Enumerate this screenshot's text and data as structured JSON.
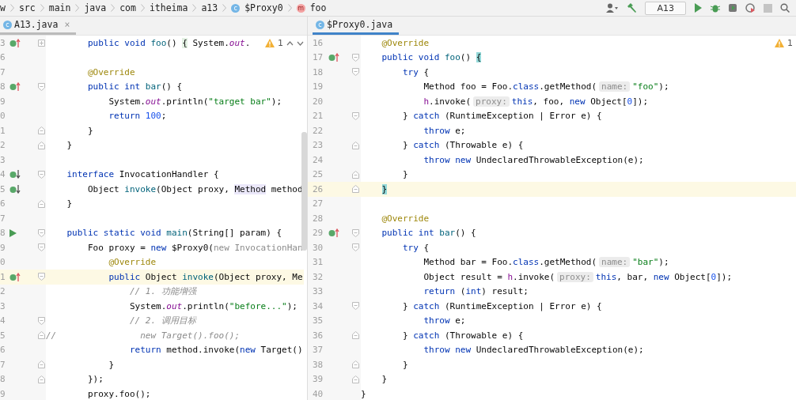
{
  "breadcrumbs": [
    {
      "label": "w",
      "kind": "folder"
    },
    {
      "label": "src",
      "kind": "folder"
    },
    {
      "label": "main",
      "kind": "folder"
    },
    {
      "label": "java",
      "kind": "folder"
    },
    {
      "label": "com",
      "kind": "folder"
    },
    {
      "label": "itheima",
      "kind": "folder"
    },
    {
      "label": "a13",
      "kind": "folder"
    },
    {
      "label": "$Proxy0",
      "kind": "class",
      "badge": "c"
    },
    {
      "label": "foo",
      "kind": "method",
      "badge": "m"
    }
  ],
  "toolbar": {
    "run_config": "A13"
  },
  "panes": [
    {
      "tab": {
        "label": "A13.java",
        "badge": "c",
        "close": "×",
        "focused": false
      },
      "warning": {
        "count": "1",
        "nav": true
      },
      "lines": [
        {
          "no": "3",
          "gutter_icon": {
            "kind": "override"
          },
          "fold": {
            "kind": "collapsed"
          },
          "current": false,
          "tokens": [
            {
              "kind": "keyword",
              "text": "        public void "
            },
            {
              "kind": "method",
              "text": "foo"
            },
            {
              "kind": "plain",
              "text": "() "
            },
            {
              "kind": "folded",
              "text": "{"
            },
            {
              "kind": "plain",
              "text": " System."
            },
            {
              "kind": "field",
              "text": "out"
            },
            {
              "kind": "plain",
              "text": "."
            }
          ]
        },
        {
          "no": "6",
          "current": false
        },
        {
          "no": "7",
          "current": false,
          "tokens": [
            {
              "kind": "annotation",
              "text": "        @Override"
            }
          ]
        },
        {
          "no": "8",
          "gutter_icon": {
            "kind": "override"
          },
          "fold": {
            "kind": "start"
          },
          "current": false,
          "tokens": [
            {
              "kind": "keyword",
              "text": "        public int "
            },
            {
              "kind": "method",
              "text": "bar"
            },
            {
              "kind": "plain",
              "text": "() {"
            }
          ]
        },
        {
          "no": "9",
          "current": false,
          "tokens": [
            {
              "kind": "plain",
              "text": "            System."
            },
            {
              "kind": "field",
              "text": "out"
            },
            {
              "kind": "plain",
              "text": ".println("
            },
            {
              "kind": "string",
              "text": "\"target bar\""
            },
            {
              "kind": "plain",
              "text": ");"
            }
          ]
        },
        {
          "no": "0",
          "current": false,
          "tokens": [
            {
              "kind": "keyword",
              "text": "            return "
            },
            {
              "kind": "number",
              "text": "100"
            },
            {
              "kind": "plain",
              "text": ";"
            }
          ]
        },
        {
          "no": "1",
          "fold": {
            "kind": "end"
          },
          "current": false,
          "tokens": [
            {
              "kind": "plain",
              "text": "        }"
            }
          ]
        },
        {
          "no": "2",
          "fold": {
            "kind": "end"
          },
          "current": false,
          "tokens": [
            {
              "kind": "plain",
              "text": "    }"
            }
          ]
        },
        {
          "no": "3",
          "current": false
        },
        {
          "no": "4",
          "gutter_icon": {
            "kind": "implemented"
          },
          "fold": {
            "kind": "start"
          },
          "current": false,
          "tokens": [
            {
              "kind": "keyword",
              "text": "    interface "
            },
            {
              "kind": "plain",
              "text": "InvocationHandler {"
            }
          ]
        },
        {
          "no": "5",
          "gutter_icon": {
            "kind": "implemented"
          },
          "current": false,
          "tokens": [
            {
              "kind": "plain",
              "text": "        Object "
            },
            {
              "kind": "method",
              "text": "invoke"
            },
            {
              "kind": "plain",
              "text": "(Object proxy, "
            },
            {
              "kind": "usage",
              "text": "Method"
            },
            {
              "kind": "plain",
              "text": " method"
            }
          ]
        },
        {
          "no": "6",
          "fold": {
            "kind": "end"
          },
          "current": false,
          "tokens": [
            {
              "kind": "plain",
              "text": "    }"
            }
          ]
        },
        {
          "no": "7",
          "current": false
        },
        {
          "no": "8",
          "gutter_icon": {
            "kind": "run"
          },
          "fold": {
            "kind": "start"
          },
          "current": false,
          "tokens": [
            {
              "kind": "keyword",
              "text": "    public static void "
            },
            {
              "kind": "method",
              "text": "main"
            },
            {
              "kind": "plain",
              "text": "(String[] param) {"
            }
          ]
        },
        {
          "no": "9",
          "fold": {
            "kind": "start"
          },
          "current": false,
          "tokens": [
            {
              "kind": "plain",
              "text": "        Foo proxy = "
            },
            {
              "kind": "keyword",
              "text": "new "
            },
            {
              "kind": "plain",
              "text": "$Proxy0("
            },
            {
              "kind": "dim",
              "text": "new InvocationHan"
            }
          ]
        },
        {
          "no": "0",
          "current": false,
          "tokens": [
            {
              "kind": "annotation",
              "text": "            @Override"
            }
          ]
        },
        {
          "no": "1",
          "gutter_icon": {
            "kind": "override"
          },
          "fold": {
            "kind": "start"
          },
          "current": true,
          "tokens": [
            {
              "kind": "keyword",
              "text": "            public "
            },
            {
              "kind": "plain",
              "text": "Object "
            },
            {
              "kind": "method",
              "text": "invoke"
            },
            {
              "kind": "plain",
              "text": "(Object proxy, Me"
            }
          ]
        },
        {
          "no": "2",
          "current": false,
          "tokens": [
            {
              "kind": "comment",
              "text": "                // 1. 功能增强"
            }
          ]
        },
        {
          "no": "3",
          "current": false,
          "tokens": [
            {
              "kind": "plain",
              "text": "                System."
            },
            {
              "kind": "field",
              "text": "out"
            },
            {
              "kind": "plain",
              "text": ".println("
            },
            {
              "kind": "string",
              "text": "\"before...\""
            },
            {
              "kind": "plain",
              "text": ");"
            }
          ]
        },
        {
          "no": "4",
          "fold": {
            "kind": "start"
          },
          "current": false,
          "tokens": [
            {
              "kind": "comment",
              "text": "                // 2. 调用目标"
            }
          ]
        },
        {
          "no": "5",
          "fold": {
            "kind": "end"
          },
          "current": false,
          "tokens": [
            {
              "kind": "comment",
              "text": "//                new Target().foo();"
            }
          ]
        },
        {
          "no": "6",
          "current": false,
          "tokens": [
            {
              "kind": "keyword",
              "text": "                return "
            },
            {
              "kind": "plain",
              "text": "method.invoke("
            },
            {
              "kind": "keyword",
              "text": "new "
            },
            {
              "kind": "plain",
              "text": "Target()"
            }
          ]
        },
        {
          "no": "7",
          "fold": {
            "kind": "end"
          },
          "current": false,
          "tokens": [
            {
              "kind": "plain",
              "text": "            }"
            }
          ]
        },
        {
          "no": "8",
          "fold": {
            "kind": "end"
          },
          "current": false,
          "tokens": [
            {
              "kind": "plain",
              "text": "        });"
            }
          ]
        },
        {
          "no": "9",
          "current": false,
          "tokens": [
            {
              "kind": "plain",
              "text": "        proxy.foo();"
            }
          ]
        }
      ]
    },
    {
      "tab": {
        "label": "$Proxy0.java",
        "badge": "c",
        "focused": true
      },
      "warning": {
        "count": "1",
        "nav": false
      },
      "lines": [
        {
          "no": "16",
          "current": false,
          "tokens": [
            {
              "kind": "annotation",
              "text": "    @Override"
            }
          ]
        },
        {
          "no": "17",
          "gutter_icon": {
            "kind": "override"
          },
          "fold": {
            "kind": "start"
          },
          "current": false,
          "tokens": [
            {
              "kind": "keyword",
              "text": "    public void "
            },
            {
              "kind": "method",
              "text": "foo"
            },
            {
              "kind": "plain",
              "text": "() "
            },
            {
              "kind": "brace",
              "text": "{"
            }
          ]
        },
        {
          "no": "18",
          "fold": {
            "kind": "start"
          },
          "current": false,
          "tokens": [
            {
              "kind": "keyword",
              "text": "        try"
            },
            {
              "kind": "plain",
              "text": " {"
            }
          ]
        },
        {
          "no": "19",
          "current": false,
          "tokens": [
            {
              "kind": "plain",
              "text": "            Method foo = Foo."
            },
            {
              "kind": "keyword",
              "text": "class"
            },
            {
              "kind": "plain",
              "text": ".getMethod("
            },
            {
              "kind": "hint",
              "text": "name:"
            },
            {
              "kind": "string",
              "text": "\"foo\""
            },
            {
              "kind": "plain",
              "text": ");"
            }
          ]
        },
        {
          "no": "20",
          "current": false,
          "tokens": [
            {
              "kind": "member",
              "text": "            h"
            },
            {
              "kind": "plain",
              "text": ".invoke("
            },
            {
              "kind": "hint",
              "text": "proxy:"
            },
            {
              "kind": "keyword",
              "text": "this"
            },
            {
              "kind": "plain",
              "text": ", foo, "
            },
            {
              "kind": "keyword",
              "text": "new "
            },
            {
              "kind": "plain",
              "text": "Object["
            },
            {
              "kind": "number",
              "text": "0"
            },
            {
              "kind": "plain",
              "text": "]);"
            }
          ]
        },
        {
          "no": "21",
          "fold": {
            "kind": "start"
          },
          "current": false,
          "tokens": [
            {
              "kind": "plain",
              "text": "        } "
            },
            {
              "kind": "keyword",
              "text": "catch"
            },
            {
              "kind": "plain",
              "text": " (RuntimeException | Error e) {"
            }
          ]
        },
        {
          "no": "22",
          "current": false,
          "tokens": [
            {
              "kind": "keyword",
              "text": "            throw"
            },
            {
              "kind": "plain",
              "text": " e;"
            }
          ]
        },
        {
          "no": "23",
          "fold": {
            "kind": "end"
          },
          "current": false,
          "tokens": [
            {
              "kind": "plain",
              "text": "        } "
            },
            {
              "kind": "keyword",
              "text": "catch"
            },
            {
              "kind": "plain",
              "text": " (Throwable e) {"
            }
          ]
        },
        {
          "no": "24",
          "current": false,
          "tokens": [
            {
              "kind": "keyword",
              "text": "            throw new "
            },
            {
              "kind": "plain",
              "text": "UndeclaredThrowableException(e);"
            }
          ]
        },
        {
          "no": "25",
          "fold": {
            "kind": "end"
          },
          "current": false,
          "tokens": [
            {
              "kind": "plain",
              "text": "        }"
            }
          ]
        },
        {
          "no": "26",
          "fold": {
            "kind": "end"
          },
          "current": true,
          "tokens": [
            {
              "kind": "brace",
              "text": "    }"
            }
          ]
        },
        {
          "no": "27",
          "current": false
        },
        {
          "no": "28",
          "current": false,
          "tokens": [
            {
              "kind": "annotation",
              "text": "    @Override"
            }
          ]
        },
        {
          "no": "29",
          "gutter_icon": {
            "kind": "override"
          },
          "fold": {
            "kind": "start"
          },
          "current": false,
          "tokens": [
            {
              "kind": "keyword",
              "text": "    public int "
            },
            {
              "kind": "method",
              "text": "bar"
            },
            {
              "kind": "plain",
              "text": "() {"
            }
          ]
        },
        {
          "no": "30",
          "fold": {
            "kind": "start"
          },
          "current": false,
          "tokens": [
            {
              "kind": "keyword",
              "text": "        try"
            },
            {
              "kind": "plain",
              "text": " {"
            }
          ]
        },
        {
          "no": "31",
          "current": false,
          "tokens": [
            {
              "kind": "plain",
              "text": "            Method bar = Foo."
            },
            {
              "kind": "keyword",
              "text": "class"
            },
            {
              "kind": "plain",
              "text": ".getMethod("
            },
            {
              "kind": "hint",
              "text": "name:"
            },
            {
              "kind": "string",
              "text": "\"bar\""
            },
            {
              "kind": "plain",
              "text": ");"
            }
          ]
        },
        {
          "no": "32",
          "current": false,
          "tokens": [
            {
              "kind": "plain",
              "text": "            Object result = "
            },
            {
              "kind": "member",
              "text": "h"
            },
            {
              "kind": "plain",
              "text": ".invoke("
            },
            {
              "kind": "hint",
              "text": "proxy:"
            },
            {
              "kind": "keyword",
              "text": "this"
            },
            {
              "kind": "plain",
              "text": ", bar, "
            },
            {
              "kind": "keyword",
              "text": "new "
            },
            {
              "kind": "plain",
              "text": "Object["
            },
            {
              "kind": "number",
              "text": "0"
            },
            {
              "kind": "plain",
              "text": "]);"
            }
          ]
        },
        {
          "no": "33",
          "current": false,
          "tokens": [
            {
              "kind": "keyword",
              "text": "            return "
            },
            {
              "kind": "plain",
              "text": "("
            },
            {
              "kind": "keyword",
              "text": "int"
            },
            {
              "kind": "plain",
              "text": ") result;"
            }
          ]
        },
        {
          "no": "34",
          "fold": {
            "kind": "start"
          },
          "current": false,
          "tokens": [
            {
              "kind": "plain",
              "text": "        } "
            },
            {
              "kind": "keyword",
              "text": "catch"
            },
            {
              "kind": "plain",
              "text": " (RuntimeException | Error e) {"
            }
          ]
        },
        {
          "no": "35",
          "current": false,
          "tokens": [
            {
              "kind": "keyword",
              "text": "            throw"
            },
            {
              "kind": "plain",
              "text": " e;"
            }
          ]
        },
        {
          "no": "36",
          "fold": {
            "kind": "end"
          },
          "current": false,
          "tokens": [
            {
              "kind": "plain",
              "text": "        } "
            },
            {
              "kind": "keyword",
              "text": "catch"
            },
            {
              "kind": "plain",
              "text": " (Throwable e) {"
            }
          ]
        },
        {
          "no": "37",
          "current": false,
          "tokens": [
            {
              "kind": "keyword",
              "text": "            throw new "
            },
            {
              "kind": "plain",
              "text": "UndeclaredThrowableException(e);"
            }
          ]
        },
        {
          "no": "38",
          "fold": {
            "kind": "end"
          },
          "current": false,
          "tokens": [
            {
              "kind": "plain",
              "text": "        }"
            }
          ]
        },
        {
          "no": "39",
          "fold": {
            "kind": "end"
          },
          "current": false,
          "tokens": [
            {
              "kind": "plain",
              "text": "    }"
            }
          ]
        },
        {
          "no": "40",
          "current": false,
          "tokens": [
            {
              "kind": "plain",
              "text": "}"
            }
          ]
        }
      ]
    }
  ]
}
